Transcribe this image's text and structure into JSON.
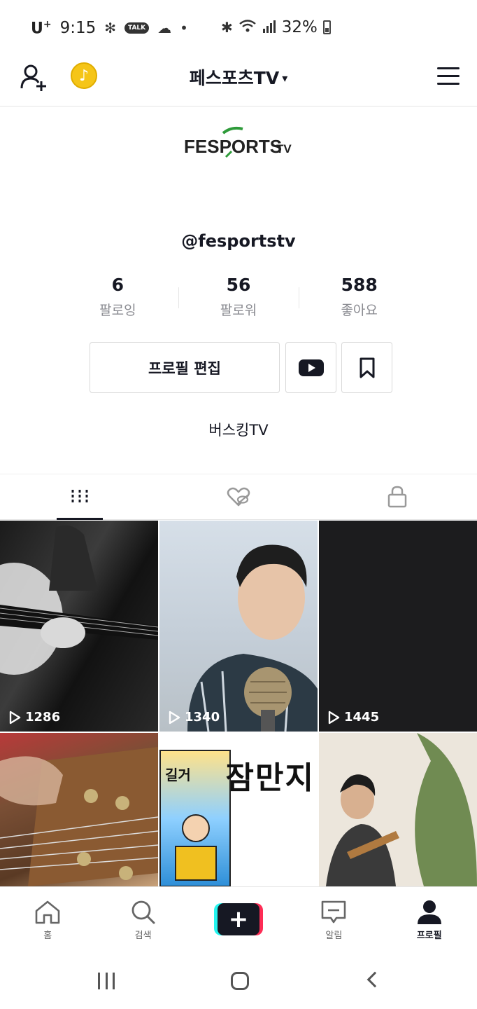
{
  "status_bar": {
    "carrier": "U",
    "carrier_sup": "+",
    "time": "9:15",
    "talk_badge": "TALK",
    "battery": "32%"
  },
  "header": {
    "title": "페스포츠TV",
    "caret": "▾"
  },
  "profile": {
    "logo_text": "FESPORTS",
    "logo_suffix": "TV",
    "username": "@fesportstv",
    "stats": [
      {
        "value": "6",
        "label": "팔로잉"
      },
      {
        "value": "56",
        "label": "팔로워"
      },
      {
        "value": "588",
        "label": "좋아요"
      }
    ],
    "edit_button": "프로필 편집",
    "bio": "버스킹TV"
  },
  "tabs": [
    {
      "icon": "grid-icon",
      "active": true
    },
    {
      "icon": "liked-hidden-icon",
      "active": false
    },
    {
      "icon": "lock-icon",
      "active": false
    }
  ],
  "videos": [
    {
      "views": "1286"
    },
    {
      "views": "1340"
    },
    {
      "views": "1445"
    },
    {
      "views": ""
    },
    {
      "views": "",
      "overlay_text": "잠만지",
      "art_text": "길거"
    },
    {
      "views": ""
    }
  ],
  "bottom_nav": [
    {
      "label": "홈",
      "icon": "home-icon"
    },
    {
      "label": "검색",
      "icon": "search-icon"
    },
    {
      "label": "",
      "icon": "create-icon"
    },
    {
      "label": "알림",
      "icon": "inbox-icon"
    },
    {
      "label": "프로필",
      "icon": "profile-icon",
      "active": true
    }
  ],
  "colors": {
    "text_primary": "#161823",
    "text_secondary": "#8a8b91",
    "accent_cyan": "#25f4ee",
    "accent_red": "#fe2c55",
    "coin": "#f5c518"
  }
}
